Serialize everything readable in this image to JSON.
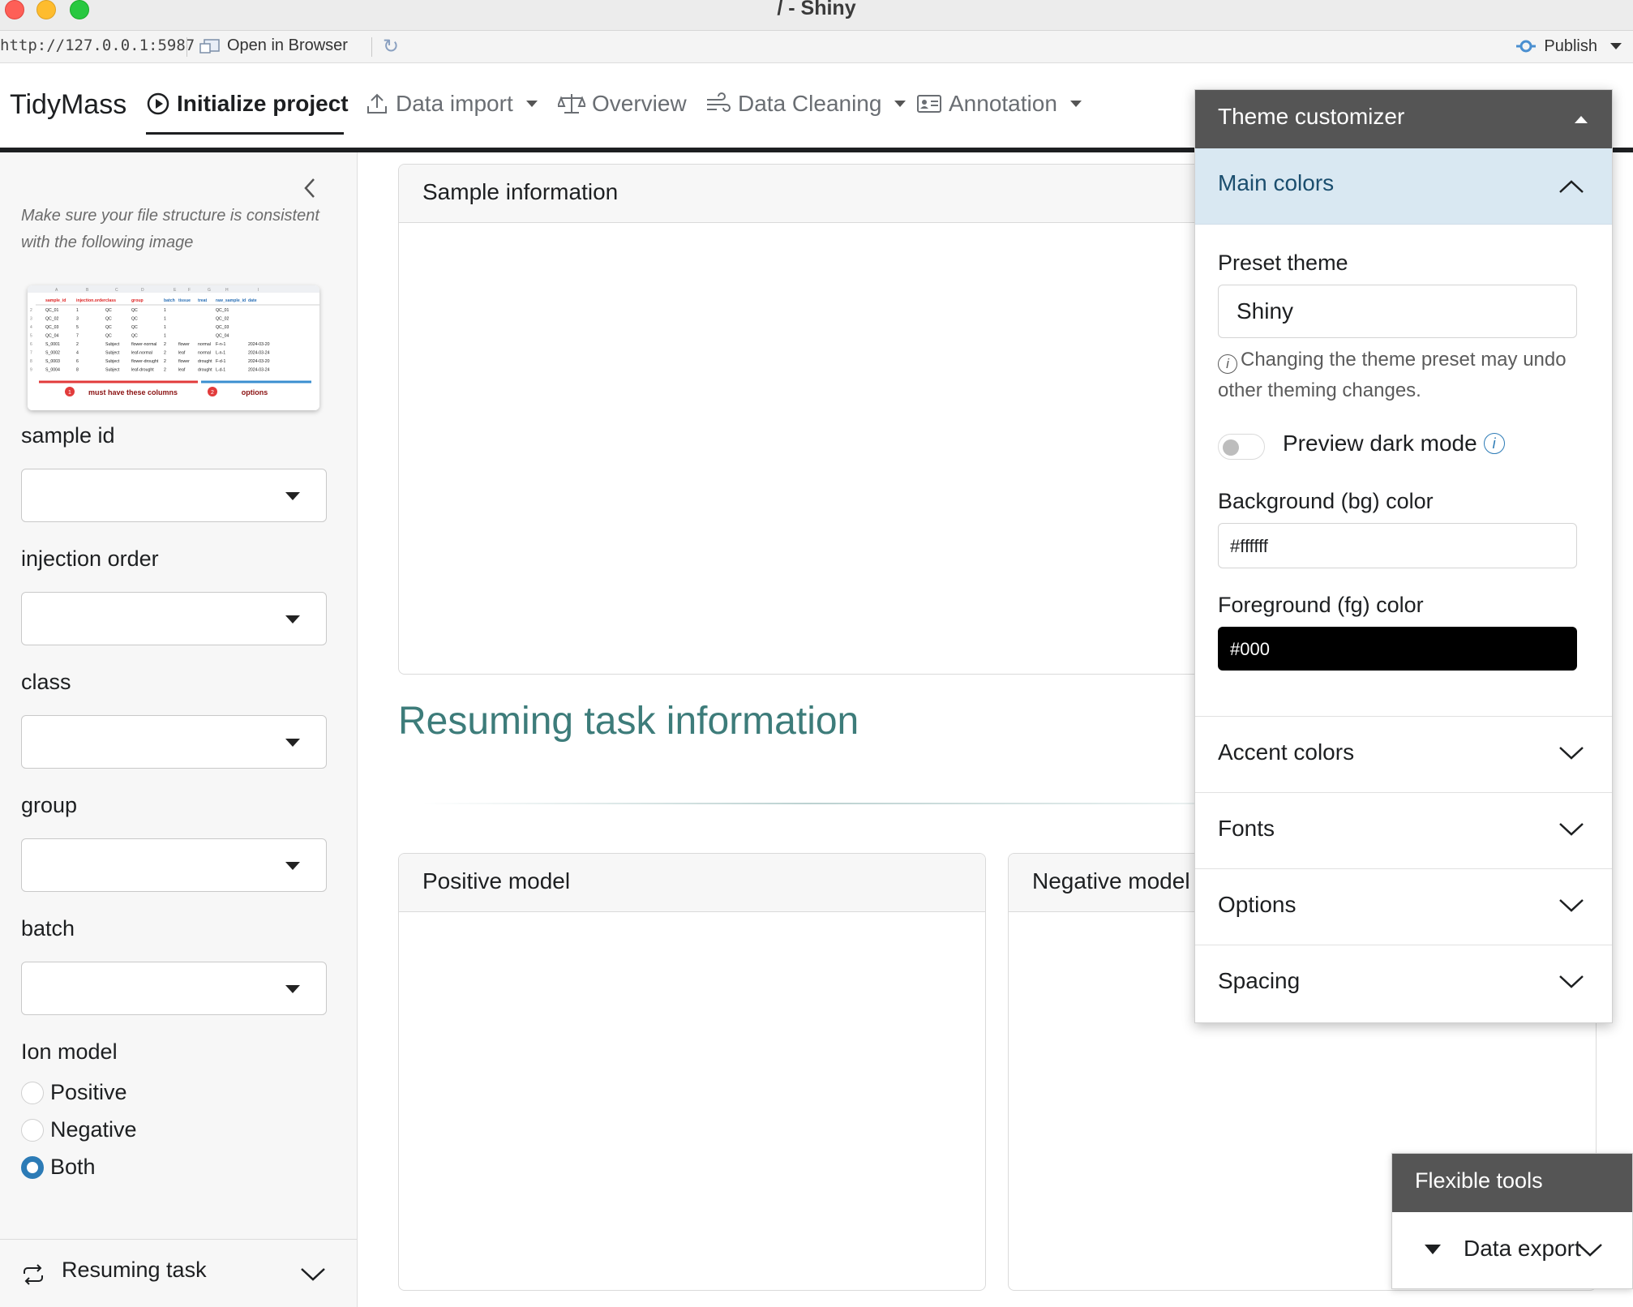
{
  "window": {
    "title": "/ - Shiny"
  },
  "viewer": {
    "url": "http://127.0.0.1:5987",
    "open_in_browser": "Open in Browser",
    "publish": "Publish"
  },
  "navbar": {
    "brand": "TidyMass",
    "items": [
      {
        "label": "Initialize project",
        "icon": "play-circle-icon",
        "active": true
      },
      {
        "label": "Data import",
        "icon": "upload-icon",
        "dropdown": true
      },
      {
        "label": "Overview",
        "icon": "balance-scale-icon"
      },
      {
        "label": "Data Cleaning",
        "icon": "wind-icon",
        "dropdown": true
      },
      {
        "label": "Annotation",
        "icon": "id-card-icon",
        "dropdown": true
      }
    ]
  },
  "sidebar": {
    "hint": "Make sure your file structure is consistent with the following image",
    "example_image": {
      "columns": [
        "sample_id",
        "injection.order",
        "class",
        "group",
        "batch",
        "tissue",
        "treat",
        "raw_sample_id",
        "date"
      ],
      "rows": [
        [
          "QC_01",
          "1",
          "QC",
          "QC",
          "1",
          "",
          "",
          "QC_01",
          ""
        ],
        [
          "QC_02",
          "3",
          "QC",
          "QC",
          "1",
          "",
          "",
          "QC_02",
          ""
        ],
        [
          "QC_03",
          "5",
          "QC",
          "QC",
          "1",
          "",
          "",
          "QC_03",
          ""
        ],
        [
          "QC_04",
          "7",
          "QC",
          "QC",
          "1",
          "",
          "",
          "QC_04",
          ""
        ],
        [
          "S_0001",
          "2",
          "Subject",
          "flower-normal",
          "2",
          "flower",
          "normal",
          "F-n-1",
          "2024-03-20"
        ],
        [
          "S_0002",
          "4",
          "Subject",
          "leaf-normal",
          "2",
          "leaf",
          "normal",
          "L-n-1",
          "2024-03-24"
        ],
        [
          "S_0003",
          "6",
          "Subject",
          "flower-drought",
          "2",
          "flower",
          "drought",
          "F-d-1",
          "2024-03-20"
        ],
        [
          "S_0004",
          "8",
          "Subject",
          "leaf-drought",
          "2",
          "leaf",
          "drought",
          "L-d-1",
          "2024-03-24"
        ]
      ],
      "note_required": "must have these columns",
      "note_optional": "options"
    },
    "fields": [
      {
        "label": "sample id",
        "value": ""
      },
      {
        "label": "injection order",
        "value": ""
      },
      {
        "label": "class",
        "value": ""
      },
      {
        "label": "group",
        "value": ""
      },
      {
        "label": "batch",
        "value": ""
      }
    ],
    "ion_model": {
      "label": "Ion model",
      "options": [
        "Positive",
        "Negative",
        "Both"
      ],
      "selected": "Both"
    },
    "footer": {
      "label": "Resuming task"
    }
  },
  "main": {
    "sample_card_title": "Sample information",
    "section_title": "Resuming task information",
    "positive_card_title": "Positive model",
    "negative_card_title": "Negative model"
  },
  "theme_customizer": {
    "title": "Theme customizer",
    "main_colors": {
      "title": "Main colors",
      "preset_label": "Preset theme",
      "preset_value": "Shiny",
      "help_text": "Changing the theme preset may undo other theming changes.",
      "dark_mode_label": "Preview dark mode",
      "dark_mode_on": false,
      "bg_label": "Background (bg) color",
      "bg_value": "#ffffff",
      "fg_label": "Foreground (fg) color",
      "fg_value": "#000"
    },
    "sections": [
      "Accent colors",
      "Fonts",
      "Options",
      "Spacing"
    ]
  },
  "flexible_tools": {
    "title": "Flexible tools",
    "item": "Data export"
  },
  "colors": {
    "accent_teal": "#3d7c7a",
    "panel_header": "#555555",
    "accordion_open_bg": "#d9e8f2",
    "radio_selected": "#2c7bb6"
  }
}
